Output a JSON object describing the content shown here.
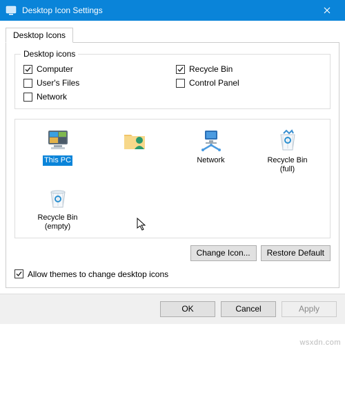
{
  "titlebar": {
    "title": "Desktop Icon Settings"
  },
  "tabs": {
    "desktop_icons": "Desktop Icons"
  },
  "group": {
    "legend": "Desktop icons",
    "items": {
      "computer": "Computer",
      "recycle_bin": "Recycle Bin",
      "users_files": "User's Files",
      "control_panel": "Control Panel",
      "network": "Network"
    },
    "checked": {
      "computer": true,
      "recycle_bin": true,
      "users_files": false,
      "control_panel": false,
      "network": false
    }
  },
  "preview": {
    "this_pc": "This PC",
    "user_folder": " ",
    "network": "Network",
    "recycle_full": "Recycle Bin\n(full)",
    "recycle_empty": "Recycle Bin\n(empty)"
  },
  "buttons": {
    "change_icon": "Change Icon...",
    "restore_default": "Restore Default",
    "ok": "OK",
    "cancel": "Cancel",
    "apply": "Apply"
  },
  "allow_themes": {
    "label": "Allow themes to change desktop icons",
    "checked": true
  },
  "watermark": "wsxdn.com"
}
